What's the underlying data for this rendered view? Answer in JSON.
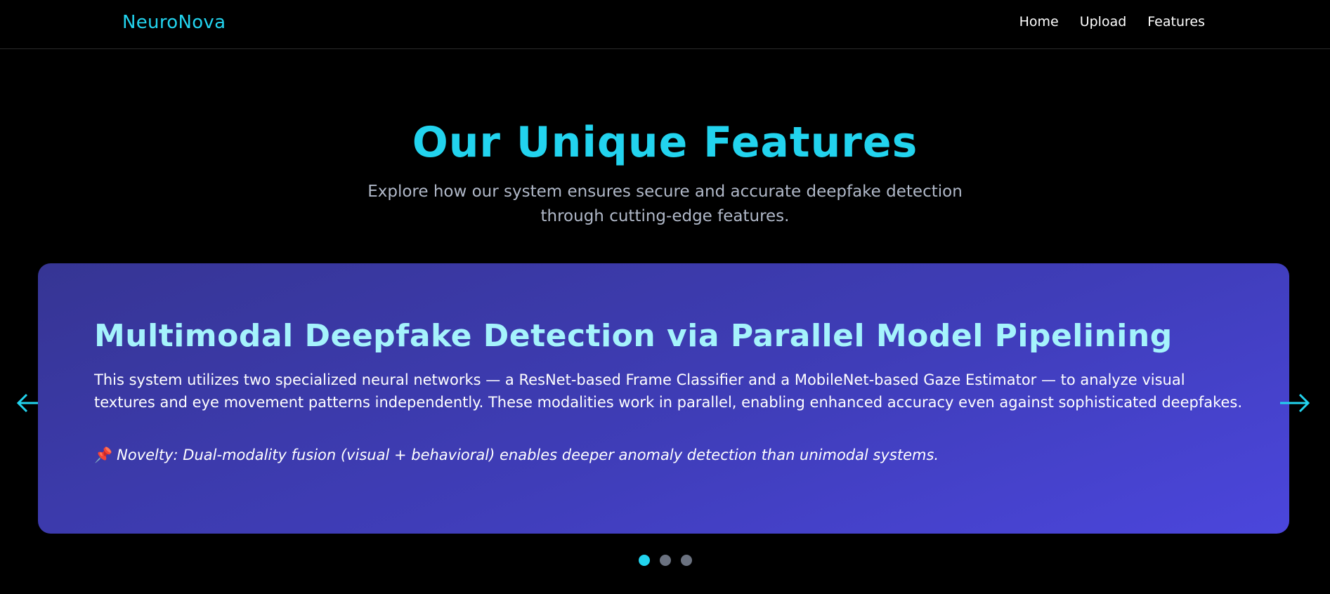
{
  "header": {
    "logo": "NeuroNova",
    "nav": [
      {
        "label": "Home"
      },
      {
        "label": "Upload"
      },
      {
        "label": "Features"
      }
    ]
  },
  "features": {
    "title": "Our Unique Features",
    "subtitle": "Explore how our system ensures secure and accurate deepfake detection through cutting-edge features."
  },
  "carousel": {
    "active_slide": 1,
    "slide_count": 3,
    "slide": {
      "title": "Multimodal Deepfake Detection via Parallel Model Pipelining",
      "description": "This system utilizes two specialized neural networks — a ResNet-based Frame Classifier and a MobileNet-based Gaze Estimator — to analyze visual textures and eye movement patterns independently. These modalities work in parallel, enabling enhanced accuracy even against sophisticated deepfakes.",
      "novelty_icon": "pushpin-icon",
      "novelty": "Novelty: Dual-modality fusion (visual + behavioral) enables deeper anomaly detection than unimodal systems."
    },
    "prev_icon": "arrow-left-icon",
    "next_icon": "arrow-right-icon"
  },
  "colors": {
    "accent": "#22d3ee",
    "background": "#000000",
    "card_start": "#363594",
    "card_end": "#4b46dc",
    "card_title": "#a5f3fc",
    "dot_inactive": "#6b7280"
  }
}
